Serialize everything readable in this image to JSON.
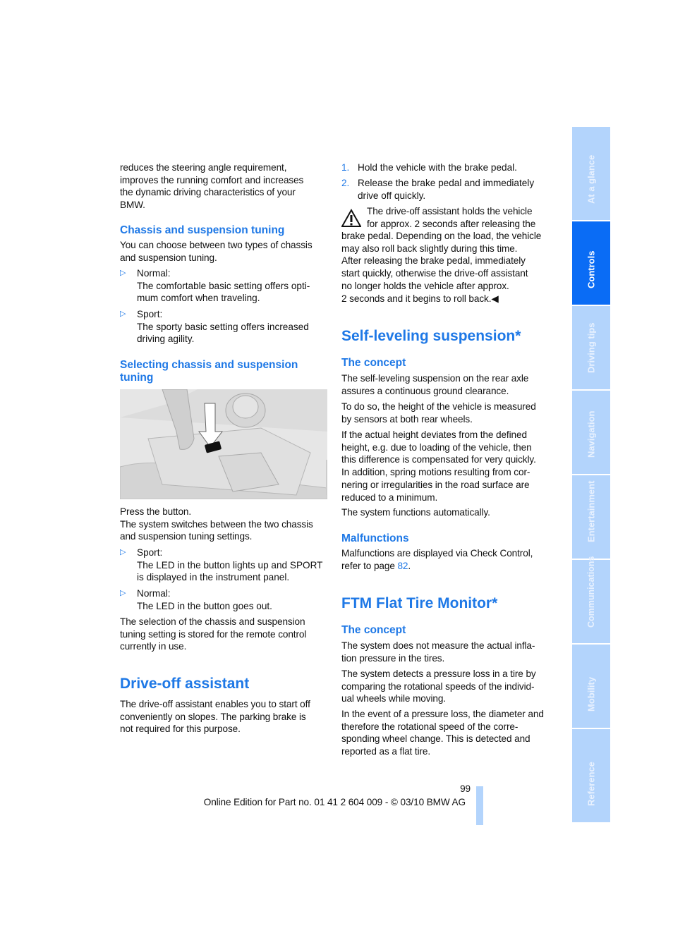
{
  "left": {
    "intro": "reduces the steering angle requirement,\nimproves the running comfort and increases\nthe dynamic driving characteristics of your\nBMW.",
    "chassis_heading": "Chassis and suspension tuning",
    "chassis_text": "You can choose between two types of chassis\nand suspension tuning.",
    "chassis_bullets": [
      {
        "text": "Normal:\nThe comfortable basic setting offers opti-\nmum comfort when traveling."
      },
      {
        "text": "Sport:\nThe sporty basic setting offers increased\ndriving agility."
      }
    ],
    "selecting_heading": "Selecting chassis and suspension\ntuning",
    "press_text": "Press the button.\nThe system switches between the two chassis\nand suspension tuning settings.",
    "press_bullets": [
      {
        "text": "Sport:\nThe LED in the button lights up and SPORT\nis displayed in the instrument panel."
      },
      {
        "text": "Normal:\nThe LED in the button goes out."
      }
    ],
    "stored_text": "The selection of the chassis and suspension\ntuning setting is stored for the remote control\ncurrently in use.",
    "driveoff_heading": "Drive-off assistant",
    "driveoff_text": "The drive-off assistant enables you to start off\nconveniently on slopes. The parking brake is\nnot required for this purpose."
  },
  "right": {
    "steps": [
      {
        "num": "1.",
        "text": "Hold the vehicle with the brake pedal."
      },
      {
        "num": "2.",
        "text": "Release the brake pedal and immediately\ndrive off quickly."
      }
    ],
    "warning_first": "The drive-off assistant holds the vehicle\nfor approx. 2 seconds after releasing the",
    "warning_rest": "brake pedal. Depending on the load, the vehicle\nmay also roll back slightly during this time.\nAfter releasing the brake pedal, immediately\nstart quickly, otherwise the drive-off assistant\nno longer holds the vehicle after approx.\n2 seconds and it begins to roll back.◀",
    "selflevel_heading": "Self-leveling suspension*",
    "concept_heading": "The concept",
    "selflevel_p1": "The self-leveling suspension on the rear axle\nassures a continuous ground clearance.",
    "selflevel_p2": "To do so, the height of the vehicle is measured\nby sensors at both rear wheels.",
    "selflevel_p3": "If the actual height deviates from the defined\nheight, e.g. due to loading of the vehicle, then\nthis difference is compensated for very quickly.\nIn addition, spring motions resulting from cor-\nnering or irregularities in the road surface are\nreduced to a minimum.",
    "selflevel_p4": "The system functions automatically.",
    "malfunctions_heading": "Malfunctions",
    "malfunctions_text": "Malfunctions are displayed via Check Control,\nrefer to page ",
    "malfunctions_page_link": "82",
    "malfunctions_end": ".",
    "ftm_heading": "FTM Flat Tire Monitor*",
    "ftm_concept_heading": "The concept",
    "ftm_p1": "The system does not measure the actual infla-\ntion pressure in the tires.",
    "ftm_p2": "The system detects a pressure loss in a tire by\ncomparing the rotational speeds of the individ-\nual wheels while moving.",
    "ftm_p3": "In the event of a pressure loss, the diameter and\ntherefore the rotational speed of the corre-\nsponding wheel change. This is detected and\nreported as a flat tire."
  },
  "footer": {
    "page_number": "99",
    "edition": "Online Edition for Part no. 01 41 2 604 009 - © 03/10 BMW AG"
  },
  "sidebar": {
    "tabs": [
      {
        "label": "At a glance"
      },
      {
        "label": "Controls",
        "active": true
      },
      {
        "label": "Driving tips"
      },
      {
        "label": "Navigation"
      },
      {
        "label": "Entertainment"
      },
      {
        "label": "Communications"
      },
      {
        "label": "Mobility"
      },
      {
        "label": "Reference"
      }
    ]
  },
  "icons": {
    "bullet": "triangle-right-icon",
    "warning": "warning-triangle-icon"
  },
  "colors": {
    "accent": "#1e78e6",
    "tab_active": "#0a6cf5",
    "tab_inactive": "#b3d4fc"
  }
}
